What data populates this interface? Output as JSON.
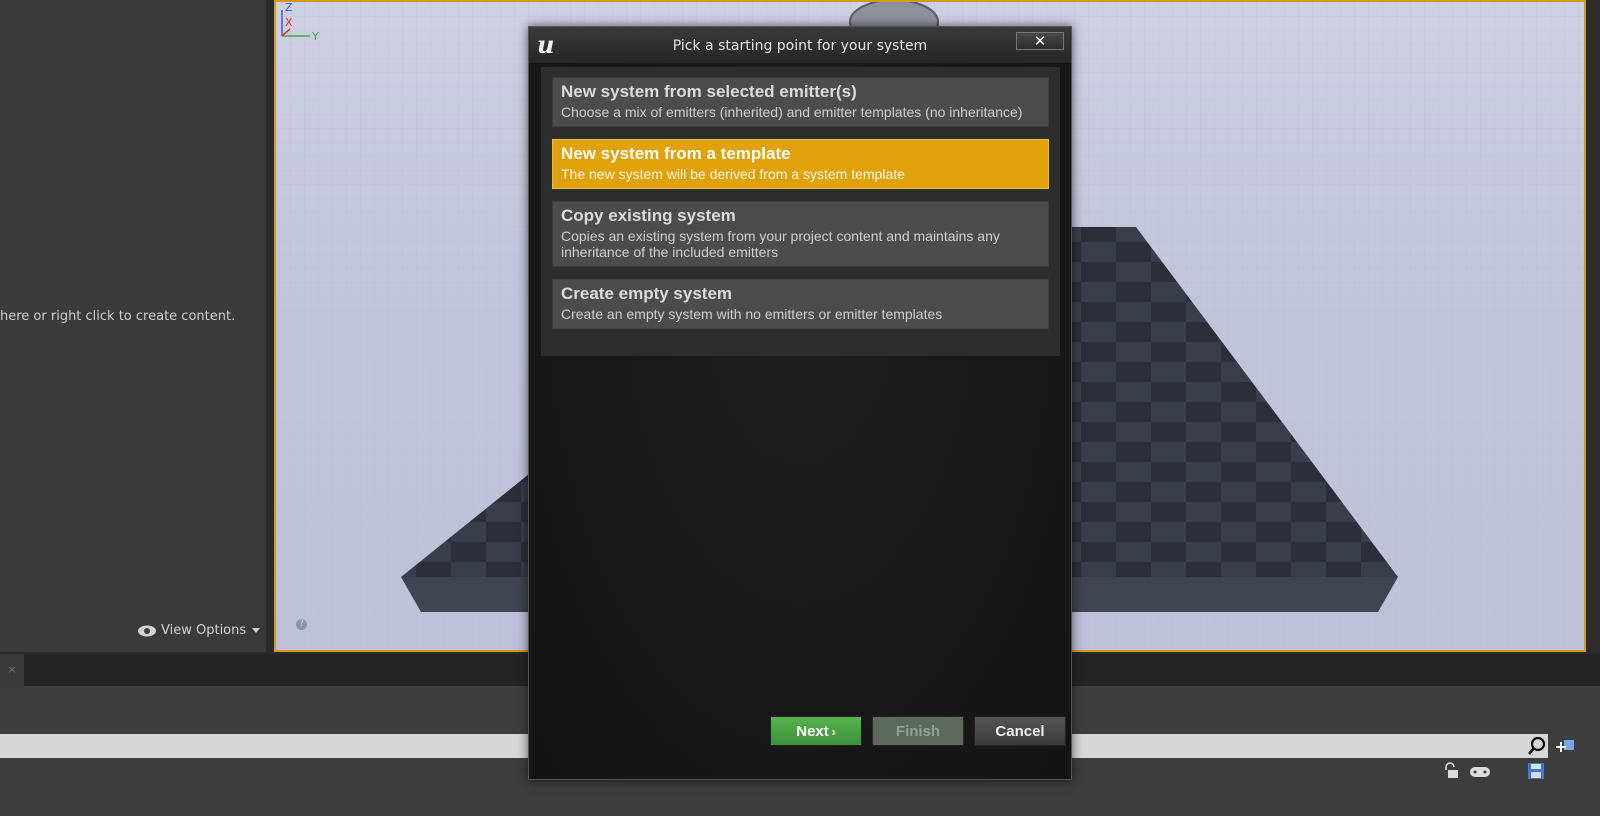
{
  "left_panel": {
    "hint_text": "here or right click to create content.",
    "view_options_label": "View Options",
    "view_options_icon": "eye-icon"
  },
  "viewport": {
    "axis_labels": {
      "z": "Z",
      "x": "X",
      "y": "Y"
    },
    "help_icon_text": "?"
  },
  "bottom": {
    "tab_close": "×"
  },
  "dialog": {
    "logo": "u",
    "title": "Pick a starting point for your system",
    "close_label": "✕",
    "options": [
      {
        "title": "New system from selected emitter(s)",
        "description": "Choose a mix of emitters (inherited) and emitter templates (no inheritance)",
        "selected": false
      },
      {
        "title": "New system from a template",
        "description": "The new system will be derived from a system template",
        "selected": true
      },
      {
        "title": "Copy existing system",
        "description": "Copies an existing system from your project content and maintains any inheritance of the included emitters",
        "selected": false
      },
      {
        "title": "Create empty system",
        "description": "Create an empty system with no emitters or emitter templates",
        "selected": false
      }
    ],
    "buttons": {
      "next": "Next",
      "finish": "Finish",
      "cancel": "Cancel"
    }
  },
  "colors": {
    "selected_option": "#e1a10a",
    "viewport_border": "#d39a22",
    "next_button": "#4aa343"
  }
}
